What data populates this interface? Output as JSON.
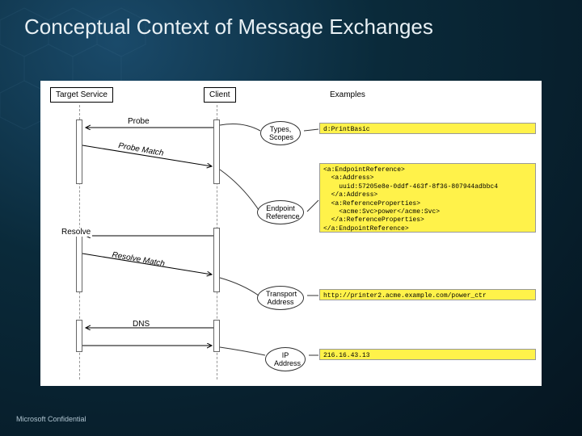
{
  "title": "Conceptual Context of Message Exchanges",
  "footer": "Microsoft Confidential",
  "actors": {
    "target": "Target Service",
    "client": "Client"
  },
  "messages": {
    "probe": "Probe",
    "probe_match": "Probe Match",
    "resolve": "Resolve",
    "resolve_match": "Resolve Match",
    "dns": "DNS"
  },
  "labels": {
    "types": "Types, Scopes",
    "endpoint": "Endpoint Reference",
    "transport": "Transport Address",
    "ip": "IP Address"
  },
  "examples_header": "Examples",
  "examples": {
    "types": "d:PrintBasic",
    "endpoint": "<a:EndpointReference>\n  <a:Address>\n    uuid:57205e8e-0ddf-463f-8f36-807944adbbc4\n  </a:Address>\n  <a:ReferenceProperties>\n    <acme:Svc>power</acme:Svc>\n  </a:ReferenceProperties>\n</a:EndpointReference>",
    "transport": "http://printer2.acme.example.com/power_ctr",
    "ip": "216.16.43.13"
  }
}
